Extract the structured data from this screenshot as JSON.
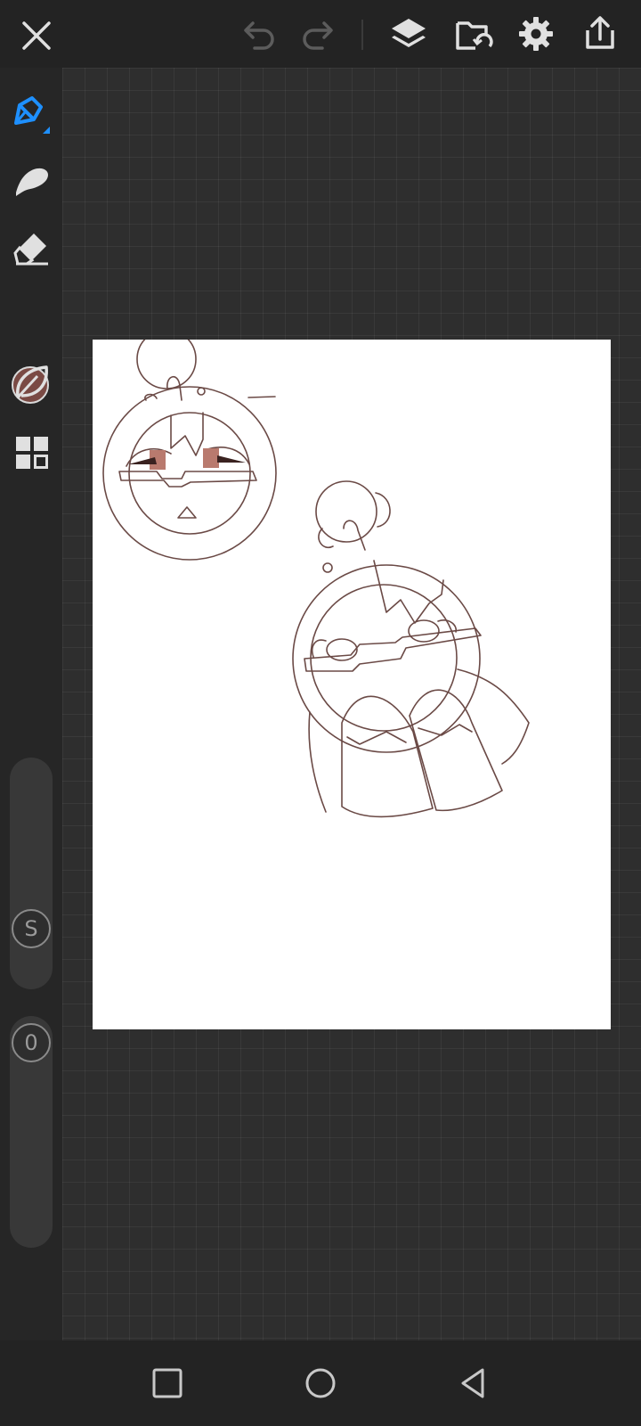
{
  "toolbar": {
    "close_icon": "close-icon",
    "undo_icon": "undo-icon",
    "redo_icon": "redo-icon",
    "layers_icon": "layers-icon",
    "gallery_icon": "gallery-icon",
    "settings_icon": "settings-icon",
    "share_icon": "share-icon"
  },
  "tools": {
    "items": [
      "pen-tool",
      "brush-tool",
      "eraser-tool",
      "color",
      "leaf-tool",
      "materials-tool"
    ],
    "active": "pen-tool",
    "active_color": "#1e90ff",
    "current_color": "#7a4a44"
  },
  "sliders": {
    "size_label": "S",
    "opacity_label": "0"
  },
  "navbar": {
    "icons": [
      "recent-apps-icon",
      "home-icon",
      "back-icon"
    ]
  }
}
